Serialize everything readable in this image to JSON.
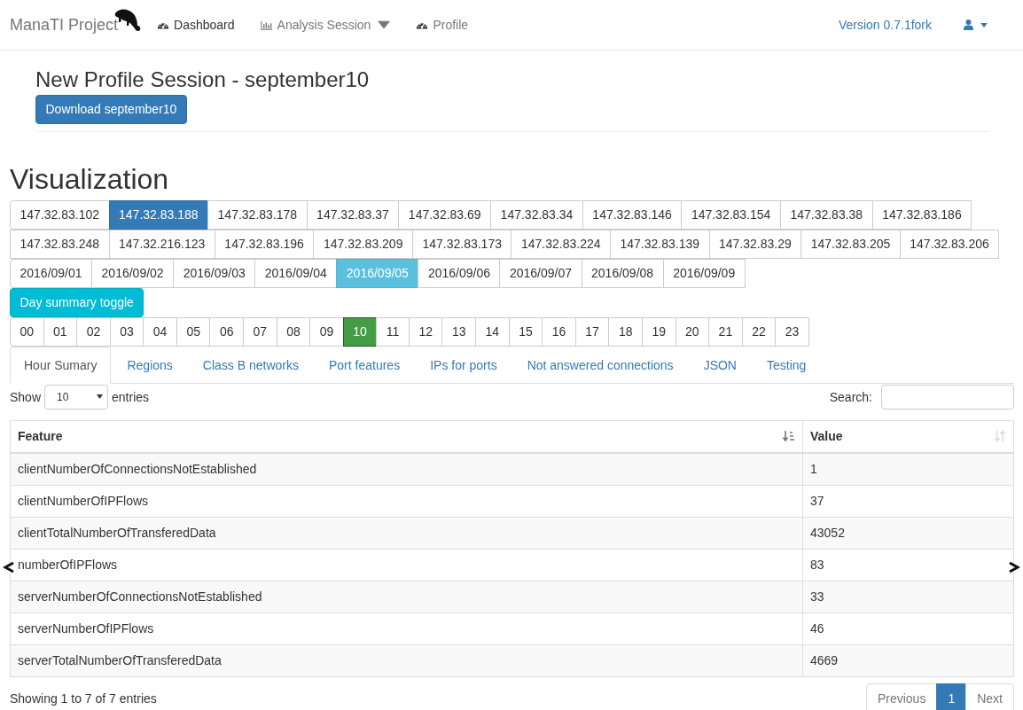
{
  "navbar": {
    "brand": "ManaTI Project",
    "items": [
      {
        "label": "Dashboard",
        "selected": true,
        "dropdown": false
      },
      {
        "label": "Analysis Session",
        "selected": false,
        "dropdown": true
      },
      {
        "label": "Profile",
        "selected": false,
        "dropdown": false
      }
    ],
    "version": "Version 0.7.1fork"
  },
  "session": {
    "title": "New Profile Session - september10",
    "download_button": "Download september10"
  },
  "visualization": {
    "heading": "Visualization",
    "ips": [
      {
        "label": "147.32.83.102",
        "selected": false
      },
      {
        "label": "147.32.83.188",
        "selected": true
      },
      {
        "label": "147.32.83.178",
        "selected": false
      },
      {
        "label": "147.32.83.37",
        "selected": false
      },
      {
        "label": "147.32.83.69",
        "selected": false
      },
      {
        "label": "147.32.83.34",
        "selected": false
      },
      {
        "label": "147.32.83.146",
        "selected": false
      },
      {
        "label": "147.32.83.154",
        "selected": false
      },
      {
        "label": "147.32.83.38",
        "selected": false
      },
      {
        "label": "147.32.83.186",
        "selected": false
      },
      {
        "label": "147.32.83.248",
        "selected": false
      },
      {
        "label": "147.32.216.123",
        "selected": false
      },
      {
        "label": "147.32.83.196",
        "selected": false
      },
      {
        "label": "147.32.83.209",
        "selected": false
      },
      {
        "label": "147.32.83.173",
        "selected": false
      },
      {
        "label": "147.32.83.224",
        "selected": false
      },
      {
        "label": "147.32.83.139",
        "selected": false
      },
      {
        "label": "147.32.83.29",
        "selected": false
      },
      {
        "label": "147.32.83.205",
        "selected": false
      },
      {
        "label": "147.32.83.206",
        "selected": false
      }
    ],
    "dates": [
      {
        "label": "2016/09/01",
        "selected": false
      },
      {
        "label": "2016/09/02",
        "selected": false
      },
      {
        "label": "2016/09/03",
        "selected": false
      },
      {
        "label": "2016/09/04",
        "selected": false
      },
      {
        "label": "2016/09/05",
        "selected": true
      },
      {
        "label": "2016/09/06",
        "selected": false
      },
      {
        "label": "2016/09/07",
        "selected": false
      },
      {
        "label": "2016/09/08",
        "selected": false
      },
      {
        "label": "2016/09/09",
        "selected": false
      }
    ],
    "day_summary_toggle": "Day summary toggle",
    "hours": [
      {
        "label": "00",
        "selected": false
      },
      {
        "label": "01",
        "selected": false
      },
      {
        "label": "02",
        "selected": false
      },
      {
        "label": "03",
        "selected": false
      },
      {
        "label": "04",
        "selected": false
      },
      {
        "label": "05",
        "selected": false
      },
      {
        "label": "06",
        "selected": false
      },
      {
        "label": "07",
        "selected": false
      },
      {
        "label": "08",
        "selected": false
      },
      {
        "label": "09",
        "selected": false
      },
      {
        "label": "10",
        "selected": true
      },
      {
        "label": "11",
        "selected": false
      },
      {
        "label": "12",
        "selected": false
      },
      {
        "label": "13",
        "selected": false
      },
      {
        "label": "14",
        "selected": false
      },
      {
        "label": "15",
        "selected": false
      },
      {
        "label": "16",
        "selected": false
      },
      {
        "label": "17",
        "selected": false
      },
      {
        "label": "18",
        "selected": false
      },
      {
        "label": "19",
        "selected": false
      },
      {
        "label": "20",
        "selected": false
      },
      {
        "label": "21",
        "selected": false
      },
      {
        "label": "22",
        "selected": false
      },
      {
        "label": "23",
        "selected": false
      }
    ],
    "tabs": [
      {
        "label": "Hour Sumary",
        "selected": true
      },
      {
        "label": "Regions",
        "selected": false
      },
      {
        "label": "Class B networks",
        "selected": false
      },
      {
        "label": "Port features",
        "selected": false
      },
      {
        "label": "IPs for ports",
        "selected": false
      },
      {
        "label": "Not answered connections",
        "selected": false
      },
      {
        "label": "JSON",
        "selected": false
      },
      {
        "label": "Testing",
        "selected": false
      }
    ]
  },
  "table_controls": {
    "show_label": "Show",
    "page_size": "10",
    "entries_label": "entries",
    "search_label": "Search:"
  },
  "table": {
    "columns": [
      "Feature",
      "Value"
    ],
    "rows": [
      [
        "clientNumberOfConnectionsNotEstablished",
        "1"
      ],
      [
        "clientNumberOfIPFlows",
        "37"
      ],
      [
        "clientTotalNumberOfTransferedData",
        "43052"
      ],
      [
        "numberOfIPFlows",
        "83"
      ],
      [
        "serverNumberOfConnectionsNotEstablished",
        "33"
      ],
      [
        "serverNumberOfIPFlows",
        "46"
      ],
      [
        "serverTotalNumberOfTransferedData",
        "4669"
      ]
    ]
  },
  "footer": {
    "info": "Showing 1 to 7 of 7 entries",
    "pagination": [
      {
        "label": "Previous",
        "selected": false
      },
      {
        "label": "1",
        "selected": true
      },
      {
        "label": "Next",
        "selected": false
      }
    ]
  }
}
